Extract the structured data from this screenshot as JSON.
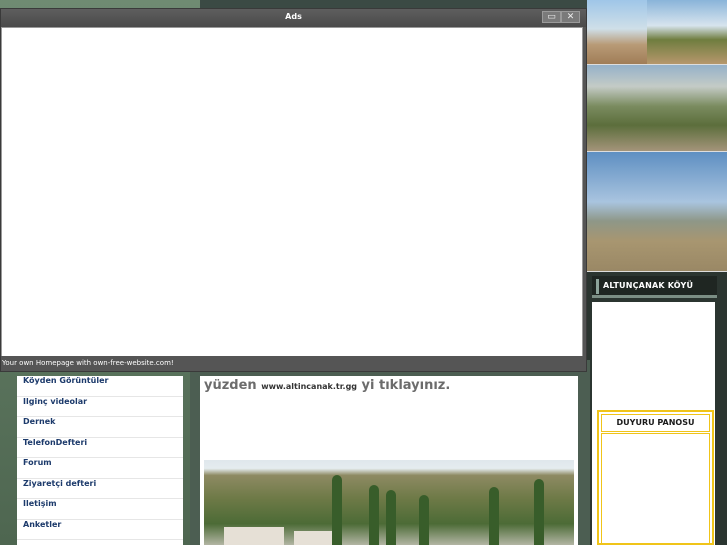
{
  "ads_window": {
    "title": "Ads",
    "maximize_icon": "▭",
    "close_icon": "✕",
    "footer_text": "Your own Homepage with own-free-website.com!"
  },
  "nav": {
    "items": [
      {
        "label": "Köyden Görüntüler"
      },
      {
        "label": "Ilginç videolar"
      },
      {
        "label": "Dernek"
      },
      {
        "label": "TelefonDefteri"
      },
      {
        "label": "Forum"
      },
      {
        "label": "Ziyaretçi defteri"
      },
      {
        "label": "Iletişim"
      },
      {
        "label": "Anketler"
      }
    ]
  },
  "content": {
    "line_start": "yüzden ",
    "url": "www.altincanak.tr.gg",
    "line_end": " yi tıklayınız."
  },
  "sidebar": {
    "village_title": "ALTUNÇANAK KÖYÜ",
    "notice_title": "DUYURU PANOSU"
  }
}
